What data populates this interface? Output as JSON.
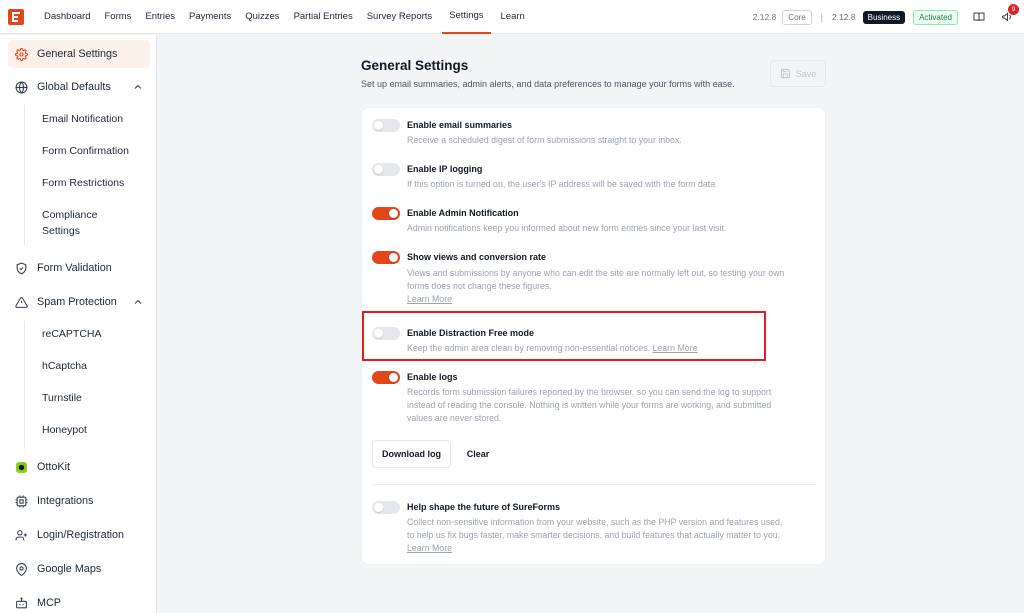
{
  "topnav": {
    "items": [
      "Dashboard",
      "Forms",
      "Entries",
      "Payments",
      "Quizzes",
      "Partial Entries",
      "Survey Reports",
      "Settings",
      "Learn"
    ],
    "active": "Settings",
    "core_version": "2.12.8",
    "core_label": "Core",
    "separator": "|",
    "business_version": "2.12.8",
    "business_label": "Business",
    "status": "Activated",
    "notification_count": "9"
  },
  "sidebar": {
    "general_settings": "General Settings",
    "global_defaults": "Global Defaults",
    "global_sub": [
      "Email Notification",
      "Form Confirmation",
      "Form Restrictions",
      "Compliance",
      "Settings"
    ],
    "form_validation": "Form Validation",
    "spam_protection": "Spam Protection",
    "spam_sub": [
      "reCAPTCHA",
      "hCaptcha",
      "Turnstile",
      "Honeypot"
    ],
    "ottokit": "OttoKit",
    "integrations": "Integrations",
    "login_registration": "Login/Registration",
    "google_maps": "Google Maps",
    "mcp": "MCP"
  },
  "main": {
    "title": "General Settings",
    "subtitle": "Set up email summaries, admin alerts, and data preferences to manage your forms with ease.",
    "save_label": "Save",
    "settings": [
      {
        "title": "Enable email summaries",
        "on": false,
        "desc": [
          "Receive a scheduled digest of form submissions straight to your inbox."
        ]
      },
      {
        "title": "Enable IP logging",
        "on": false,
        "desc": [
          "If this option is turned on, the user's IP address will be saved with the form data"
        ]
      },
      {
        "title": "Enable Admin Notification",
        "on": true,
        "desc": [
          "Admin notifications keep you informed about new form entries since your last visit."
        ]
      },
      {
        "title": "Show views and conversion rate",
        "on": true,
        "desc": [
          "Views and submissions by anyone who can edit the site are normally left out, so testing your own",
          "forms does not change these figures."
        ],
        "link": "Learn More"
      },
      {
        "title": "Enable Distraction Free mode",
        "on": false,
        "desc": [
          "Keep the admin area clean by removing non-essential notices."
        ],
        "link": "Learn More"
      },
      {
        "title": "Enable logs",
        "on": true,
        "desc": [
          "Records form submission failures reported by the browser, so you can send the log to support",
          "instead of reading the console. Nothing is written while your forms are working, and submitted",
          "values are never stored."
        ]
      },
      {
        "title": "Help shape the future of SureForms",
        "on": false,
        "desc": [
          "Collect non-sensitive information from your website, such as the PHP version and features used,",
          "to help us fix bugs faster, make smarter decisions, and build features that actually matter to you."
        ],
        "link": "Learn More"
      }
    ],
    "download_log": "Download log",
    "clear": "Clear"
  },
  "colors": {
    "accent": "#e3461b",
    "highlight": "#e11d1d"
  }
}
